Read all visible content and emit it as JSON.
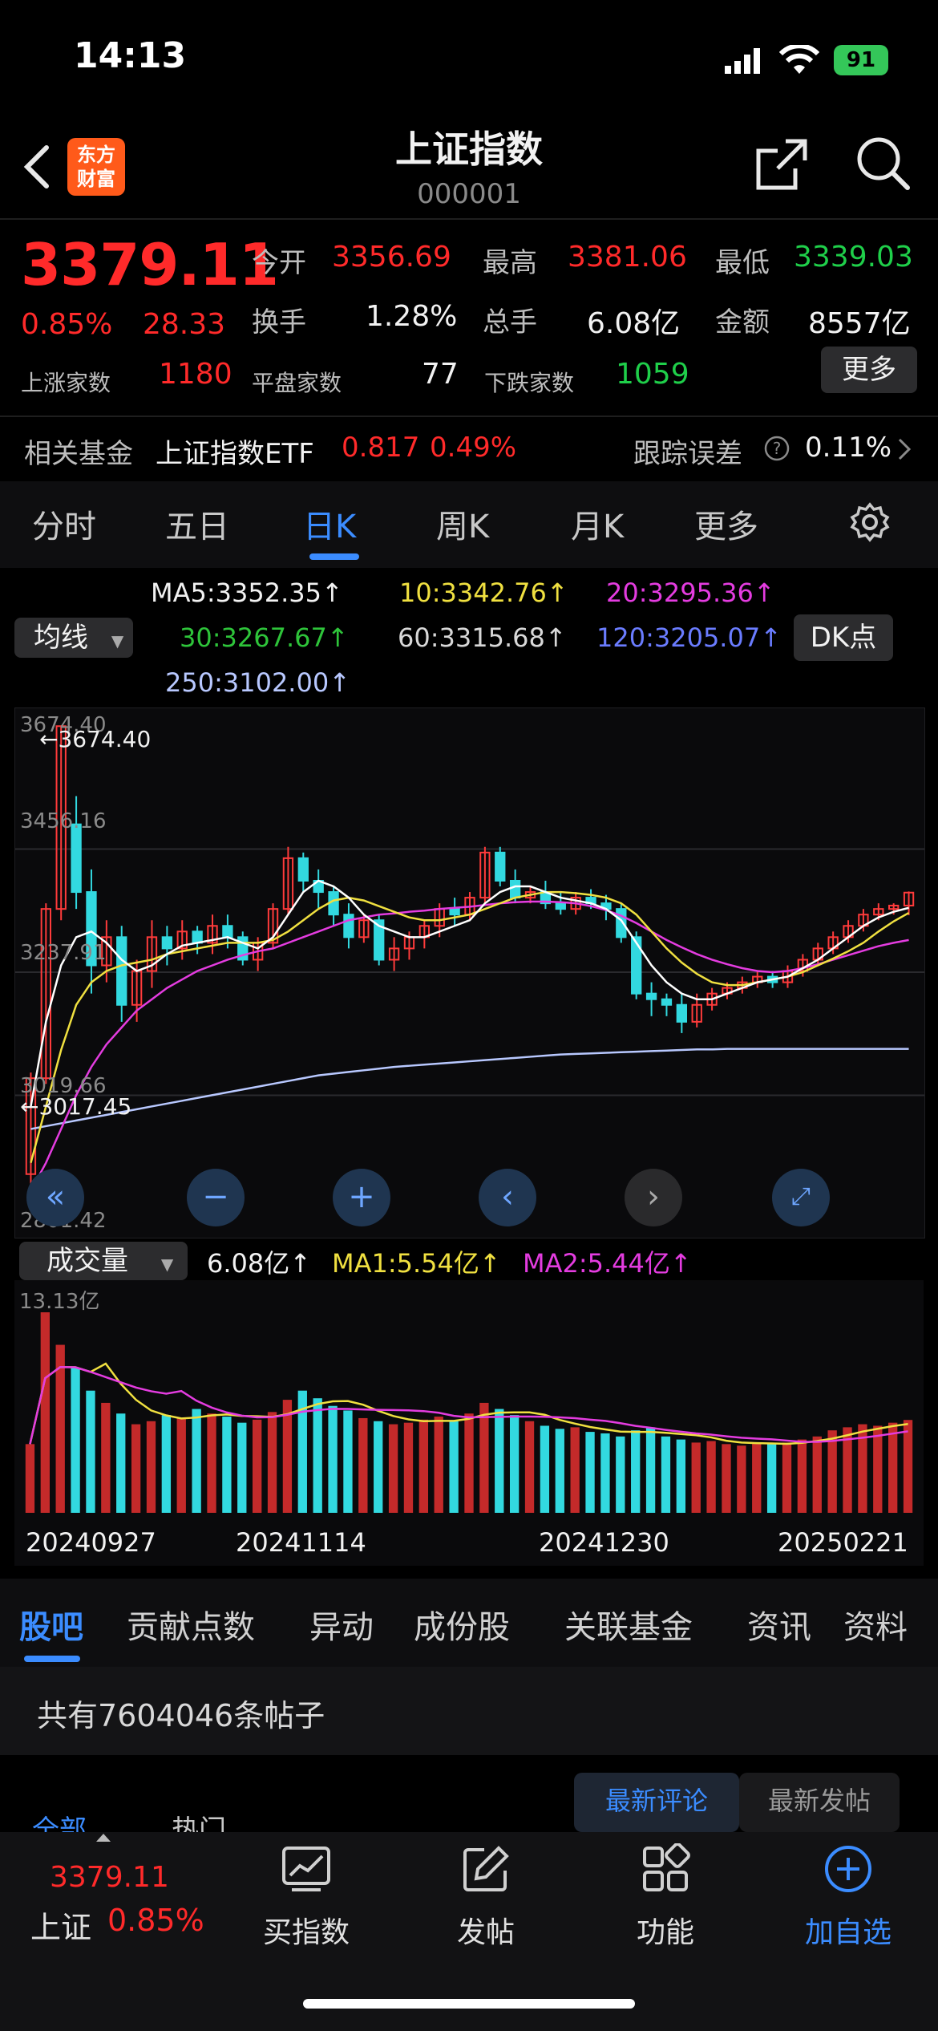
{
  "status": {
    "time": "14:13",
    "battery": "91"
  },
  "header": {
    "logo_line1": "东方",
    "logo_line2": "财富",
    "title": "上证指数",
    "code": "000001"
  },
  "quote": {
    "price": "3379.11",
    "change_pct": "0.85%",
    "change": "28.33",
    "open_label": "今开",
    "open": "3356.69",
    "high_label": "最高",
    "high": "3381.06",
    "low_label": "最低",
    "low": "3339.03",
    "turnover_label": "换手",
    "turnover": "1.28%",
    "volume_label": "总手",
    "volume": "6.08亿",
    "amount_label": "金额",
    "amount": "8557亿",
    "up_label": "上涨家数",
    "up": "1180",
    "flat_label": "平盘家数",
    "flat": "77",
    "down_label": "下跌家数",
    "down": "1059",
    "more": "更多"
  },
  "fund": {
    "label": "相关基金",
    "name": "上证指数ETF",
    "price": "0.817",
    "pct": "0.49%",
    "track_label": "跟踪误差",
    "track": "0.11%"
  },
  "tabs": [
    "分时",
    "五日",
    "日K",
    "周K",
    "月K",
    "更多"
  ],
  "ma": {
    "dropdown": "均线",
    "ma5": "MA5:3352.35",
    "ma10": "10:3342.76",
    "ma20": "20:3295.36",
    "ma30": "30:3267.67",
    "ma60": "60:3315.68",
    "ma120": "120:3205.07",
    "ma250": "250:3102.00",
    "dk": "DK点"
  },
  "kchart_labels": {
    "top": "3674.40",
    "high_marker": "3674.40",
    "y2": "3456.16",
    "y3": "3237.91",
    "y4": "3019.66",
    "low_marker": "3017.45",
    "bottom": "2801.42"
  },
  "volume": {
    "dropdown": "成交量",
    "vol": "6.08亿",
    "ma1": "MA1:5.54亿",
    "ma2": "MA2:5.44亿",
    "top": "13.13亿"
  },
  "dates": [
    "20240927",
    "20241114",
    "20241230",
    "20250221"
  ],
  "section_tabs": [
    "股吧",
    "贡献点数",
    "异动",
    "成份股",
    "关联基金",
    "资讯",
    "资料"
  ],
  "posts": {
    "text": "共有7604046条帖子"
  },
  "sub_tabs": {
    "all": "全部",
    "hot": "热门",
    "latest_comment": "最新评论",
    "latest_post": "最新发帖"
  },
  "bottom_nav": {
    "price": "3379.11",
    "name": "上证",
    "pct": "0.85%",
    "buy": "买指数",
    "post": "发帖",
    "func": "功能",
    "add": "加自选"
  },
  "colors": {
    "up": "#ff2a2a",
    "down": "#1fcf4a",
    "accent": "#3b8cff",
    "teal": "#32d9e0"
  },
  "chart_data": {
    "type": "candlestick",
    "y_range": [
      2801.42,
      3674.4
    ],
    "candles": [
      [
        2880,
        3050,
        2850,
        3060
      ],
      [
        3050,
        3350,
        3040,
        3360
      ],
      [
        3350,
        3674,
        3330,
        3674
      ],
      [
        3500,
        3380,
        3350,
        3550
      ],
      [
        3380,
        3250,
        3200,
        3420
      ],
      [
        3250,
        3300,
        3220,
        3330
      ],
      [
        3300,
        3180,
        3150,
        3320
      ],
      [
        3180,
        3240,
        3150,
        3260
      ],
      [
        3240,
        3300,
        3210,
        3330
      ],
      [
        3300,
        3280,
        3250,
        3320
      ],
      [
        3280,
        3310,
        3260,
        3330
      ],
      [
        3310,
        3290,
        3270,
        3320
      ],
      [
        3290,
        3320,
        3270,
        3340
      ],
      [
        3320,
        3300,
        3280,
        3340
      ],
      [
        3300,
        3260,
        3250,
        3310
      ],
      [
        3260,
        3290,
        3240,
        3300
      ],
      [
        3290,
        3350,
        3280,
        3360
      ],
      [
        3350,
        3440,
        3340,
        3460
      ],
      [
        3440,
        3400,
        3380,
        3450
      ],
      [
        3400,
        3380,
        3350,
        3420
      ],
      [
        3380,
        3340,
        3320,
        3390
      ],
      [
        3340,
        3300,
        3280,
        3360
      ],
      [
        3300,
        3330,
        3290,
        3340
      ],
      [
        3330,
        3260,
        3250,
        3340
      ],
      [
        3260,
        3280,
        3240,
        3300
      ],
      [
        3280,
        3300,
        3260,
        3310
      ],
      [
        3300,
        3320,
        3280,
        3330
      ],
      [
        3320,
        3350,
        3300,
        3360
      ],
      [
        3350,
        3340,
        3320,
        3370
      ],
      [
        3340,
        3370,
        3330,
        3380
      ],
      [
        3370,
        3450,
        3360,
        3460
      ],
      [
        3450,
        3400,
        3390,
        3460
      ],
      [
        3400,
        3370,
        3360,
        3420
      ],
      [
        3370,
        3380,
        3360,
        3390
      ],
      [
        3380,
        3360,
        3350,
        3400
      ],
      [
        3360,
        3350,
        3340,
        3380
      ],
      [
        3350,
        3370,
        3340,
        3380
      ],
      [
        3370,
        3360,
        3350,
        3385
      ],
      [
        3360,
        3350,
        3330,
        3375
      ],
      [
        3350,
        3300,
        3290,
        3360
      ],
      [
        3300,
        3200,
        3190,
        3310
      ],
      [
        3200,
        3190,
        3160,
        3220
      ],
      [
        3190,
        3180,
        3160,
        3200
      ],
      [
        3180,
        3150,
        3130,
        3200
      ],
      [
        3150,
        3180,
        3140,
        3200
      ],
      [
        3180,
        3200,
        3170,
        3210
      ],
      [
        3200,
        3210,
        3190,
        3220
      ],
      [
        3210,
        3220,
        3200,
        3230
      ],
      [
        3220,
        3230,
        3210,
        3240
      ],
      [
        3230,
        3220,
        3210,
        3240
      ],
      [
        3220,
        3240,
        3210,
        3250
      ],
      [
        3240,
        3260,
        3230,
        3270
      ],
      [
        3260,
        3280,
        3250,
        3290
      ],
      [
        3280,
        3300,
        3270,
        3310
      ],
      [
        3300,
        3320,
        3290,
        3330
      ],
      [
        3320,
        3340,
        3310,
        3350
      ],
      [
        3340,
        3350,
        3330,
        3360
      ],
      [
        3350,
        3356,
        3340,
        3360
      ],
      [
        3356,
        3379,
        3339,
        3381
      ]
    ],
    "ma5": [
      3000,
      3150,
      3250,
      3300,
      3310,
      3290,
      3260,
      3240,
      3250,
      3270,
      3285,
      3290,
      3295,
      3300,
      3290,
      3280,
      3300,
      3340,
      3380,
      3400,
      3390,
      3370,
      3340,
      3320,
      3310,
      3300,
      3300,
      3310,
      3320,
      3330,
      3360,
      3380,
      3390,
      3390,
      3380,
      3370,
      3365,
      3360,
      3350,
      3330,
      3290,
      3250,
      3220,
      3200,
      3190,
      3190,
      3200,
      3210,
      3220,
      3225,
      3230,
      3245,
      3260,
      3280,
      3300,
      3320,
      3335,
      3345,
      3352
    ],
    "ma10": [
      2900,
      3000,
      3100,
      3180,
      3220,
      3240,
      3250,
      3255,
      3260,
      3270,
      3275,
      3280,
      3285,
      3290,
      3290,
      3290,
      3295,
      3310,
      3330,
      3350,
      3365,
      3370,
      3365,
      3355,
      3345,
      3335,
      3330,
      3330,
      3335,
      3340,
      3350,
      3360,
      3370,
      3375,
      3380,
      3380,
      3378,
      3375,
      3370,
      3360,
      3340,
      3310,
      3280,
      3255,
      3235,
      3220,
      3215,
      3215,
      3220,
      3225,
      3230,
      3238,
      3250,
      3262,
      3275,
      3290,
      3310,
      3328,
      3343
    ],
    "ma20": [
      2850,
      2900,
      2960,
      3020,
      3070,
      3110,
      3140,
      3170,
      3190,
      3210,
      3225,
      3240,
      3250,
      3260,
      3268,
      3275,
      3280,
      3290,
      3300,
      3310,
      3320,
      3330,
      3335,
      3340,
      3342,
      3345,
      3347,
      3350,
      3352,
      3354,
      3357,
      3360,
      3362,
      3363,
      3363,
      3362,
      3360,
      3355,
      3348,
      3338,
      3325,
      3310,
      3295,
      3282,
      3270,
      3260,
      3252,
      3245,
      3240,
      3238,
      3240,
      3245,
      3252,
      3260,
      3268,
      3276,
      3284,
      3290,
      3295
    ],
    "ma250": [
      2960,
      2965,
      2970,
      2975,
      2980,
      2985,
      2990,
      2995,
      3000,
      3005,
      3010,
      3015,
      3020,
      3025,
      3030,
      3035,
      3040,
      3045,
      3050,
      3055,
      3058,
      3061,
      3064,
      3067,
      3070,
      3072,
      3074,
      3076,
      3078,
      3080,
      3082,
      3084,
      3086,
      3088,
      3090,
      3092,
      3093,
      3094,
      3095,
      3096,
      3097,
      3098,
      3099,
      3100,
      3101,
      3101,
      3102,
      3102,
      3102,
      3102,
      3102,
      3102,
      3102,
      3102,
      3102,
      3102,
      3102,
      3102,
      3102
    ],
    "volume_range": [
      0,
      13.13
    ],
    "volumes": [
      4.5,
      13.13,
      11.0,
      9.5,
      8.0,
      7.2,
      6.5,
      5.8,
      6.0,
      6.4,
      6.2,
      6.8,
      6.5,
      6.3,
      5.9,
      6.1,
      6.6,
      7.4,
      8.0,
      7.5,
      7.0,
      6.7,
      6.2,
      6.0,
      5.8,
      5.9,
      6.1,
      6.3,
      6.0,
      6.5,
      7.2,
      6.8,
      6.4,
      6.0,
      5.7,
      5.5,
      5.6,
      5.3,
      5.2,
      5.0,
      5.4,
      5.6,
      5.0,
      4.8,
      4.6,
      4.7,
      4.5,
      4.4,
      4.6,
      4.5,
      4.6,
      4.8,
      5.0,
      5.4,
      5.6,
      5.8,
      5.7,
      5.9,
      6.08
    ]
  }
}
